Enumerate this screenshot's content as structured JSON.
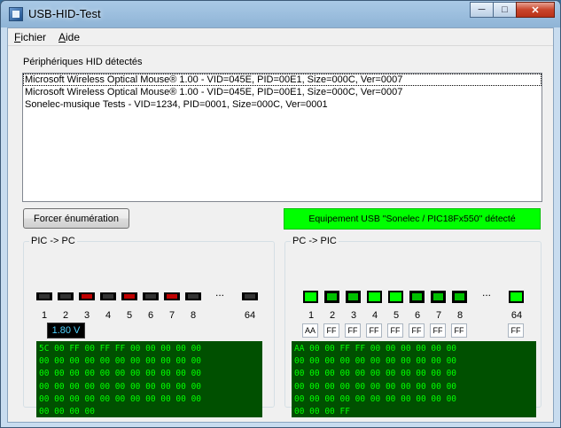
{
  "window": {
    "title": "USB-HID-Test"
  },
  "menu": {
    "items": [
      {
        "label": "Fichier",
        "ul": "F",
        "rest": "ichier"
      },
      {
        "label": "Aide",
        "ul": "A",
        "rest": "ide"
      }
    ]
  },
  "hid": {
    "label": "Périphériques HID détectés",
    "devices": [
      "Microsoft Wireless Optical Mouse® 1.00 - VID=045E, PID=00E1, Size=000C, Ver=0007",
      "Microsoft Wireless Optical Mouse® 1.00 - VID=045E, PID=00E1, Size=000C, Ver=0007",
      "Sonelec-musique Tests - VID=1234, PID=0001, Size=000C, Ver=0001"
    ]
  },
  "buttons": {
    "enumerate": "Forcer énumération"
  },
  "status": {
    "text": "Equipement USB \"Sonelec / PIC18Fx550\" détecté",
    "color": "#00ff00"
  },
  "pic_to_pc": {
    "title": "PIC -> PC",
    "leds": [
      "off",
      "off",
      "red",
      "off",
      "red",
      "off",
      "red",
      "off"
    ],
    "led_64": "off",
    "numbers": [
      "1",
      "2",
      "3",
      "4",
      "5",
      "6",
      "7",
      "8"
    ],
    "num_64": "64",
    "ellipsis": "...",
    "voltage": "1.80 V",
    "hex": "5C 00 FF 00 FF FF 00 00 00 00 00\n00 00 00 00 00 00 00 00 00 00 00\n00 00 00 00 00 00 00 00 00 00 00\n00 00 00 00 00 00 00 00 00 00 00\n00 00 00 00 00 00 00 00 00 00 00\n00 00 00 00"
  },
  "pc_to_pic": {
    "title": "PC -> PIC",
    "leds": [
      "on",
      "off",
      "off",
      "on",
      "on",
      "off",
      "off",
      "off"
    ],
    "led_64": "on",
    "numbers": [
      "1",
      "2",
      "3",
      "4",
      "5",
      "6",
      "7",
      "8"
    ],
    "num_64": "64",
    "ellipsis": "...",
    "bytes": [
      "AA",
      "FF",
      "FF",
      "FF",
      "FF",
      "FF",
      "FF",
      "FF"
    ],
    "byte_64": "FF",
    "hex": "AA 00 00 FF FF 00 00 00 00 00 00\n00 00 00 00 00 00 00 00 00 00 00\n00 00 00 00 00 00 00 00 00 00 00\n00 00 00 00 00 00 00 00 00 00 00\n00 00 00 00 00 00 00 00 00 00 00\n00 00 00 FF"
  }
}
